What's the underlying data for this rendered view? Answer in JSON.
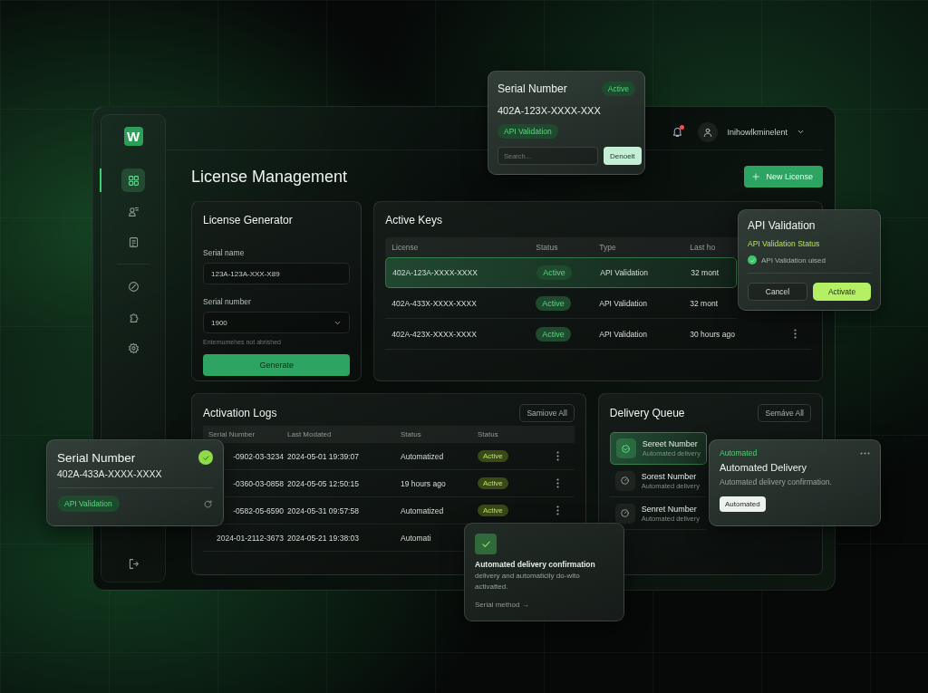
{
  "serial_popover": {
    "title": "Serial Number",
    "badge": "Active",
    "serial": "402A-123X-XXXX-XXX",
    "tag": "API Validation",
    "search_placeholder": "Search...",
    "button": "Denoeit"
  },
  "sidebar": {
    "logo": "W",
    "items": [
      {
        "selected": true
      },
      {
        "selected": false
      },
      {
        "selected": false
      },
      {
        "selected": false
      },
      {
        "selected": false
      },
      {
        "selected": false
      }
    ]
  },
  "topbar": {
    "notification": true,
    "user_name": "Inihowlkminelent"
  },
  "page_title": "License Management",
  "new_license_button": "New License",
  "generator": {
    "title": "License Generator",
    "fields": [
      {
        "label": "Serial name",
        "value": "123A-123A-XXX-X89",
        "kind": "text"
      },
      {
        "label": "Serial number",
        "value": "1900",
        "kind": "select"
      }
    ],
    "hint": "Enternumehes not abrished",
    "button": "Generate"
  },
  "active_keys": {
    "title": "Active Keys",
    "columns": [
      "License",
      "Status",
      "Type",
      "Last ho"
    ],
    "rows": [
      {
        "license": "402A-123A-XXXX-XXXX",
        "status": "Active",
        "type": "API Validation",
        "last": "32 mont",
        "selected": true,
        "menu": false
      },
      {
        "license": "402A-433X-XXXX-XXXX",
        "status": "Active",
        "type": "API Validation",
        "last": "32 mont",
        "selected": false,
        "menu": false
      },
      {
        "license": "402A-423X-XXXX-XXXX",
        "status": "Active",
        "type": "API Validation",
        "last": "30 hours ago",
        "selected": false,
        "menu": true
      }
    ]
  },
  "api_popover": {
    "title": "API Validation",
    "subtitle": "API Validation Status",
    "check_text": "API Validation uised",
    "buttons": [
      "Cancel",
      "Activate"
    ]
  },
  "activation_logs": {
    "title": "Activation Logs",
    "action": "Samiove All",
    "columns": [
      "Serial Number",
      "Last Modated",
      "Status",
      "Status"
    ],
    "rows": [
      {
        "serial": "-0902-03-3234",
        "modified": "2024-05-01 19:39:07",
        "status": "Automatized",
        "badge": "Active"
      },
      {
        "serial": "-0360-03-0858",
        "modified": "2024-05-05 12:50:15",
        "status": "19 hours ago",
        "badge": "Active"
      },
      {
        "serial": "-0582-05-6590",
        "modified": "2024-05-31 09:57:58",
        "status": "Automatized",
        "badge": "Active"
      },
      {
        "serial": "2024-01-2112-3673",
        "modified": "2024-05-21 19:38:03",
        "status": "Automati"
      }
    ]
  },
  "delivery_queue": {
    "title": "Delivery Queue",
    "action": "Semáve All",
    "items": [
      {
        "title": "Sereet Number",
        "subtitle": "Automated delivery",
        "selected": true
      },
      {
        "title": "Sorest Number",
        "subtitle": "Automated delivery",
        "selected": false
      },
      {
        "title": "Senret Number",
        "subtitle": "Automated delivery",
        "selected": false
      }
    ]
  },
  "delivery_popover": {
    "label": "Automated",
    "title": "Automated Delivery",
    "text": "Automated delivery confirmation.",
    "button": "Automated"
  },
  "serial_card": {
    "title": "Serial Number",
    "serial": "402A-433A-XXXX-XXXX",
    "tag": "API Validation",
    "verified": true
  },
  "confirmation_card": {
    "title": "Automated delivery confirmation",
    "text": "delivery and automaticily do-wito activatted.",
    "link": "Serial method →"
  }
}
